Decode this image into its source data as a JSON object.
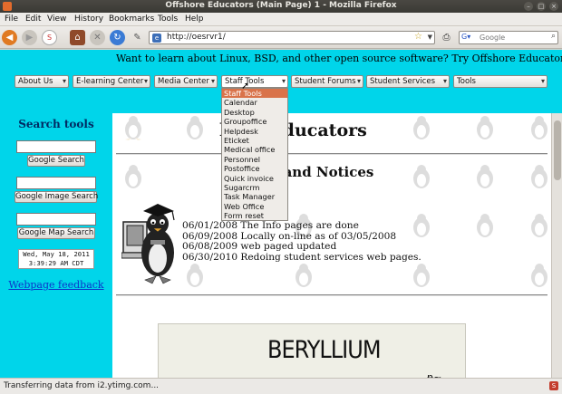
{
  "window": {
    "title": "Offshore Educators (Main Page) 1 - Mozilla Firefox"
  },
  "menubar": {
    "items": [
      "File",
      "Edit",
      "View",
      "History",
      "Bookmarks",
      "Tools",
      "Help"
    ]
  },
  "navbar": {
    "url": "http://oesrvr1/",
    "search_placeholder": "Google"
  },
  "page": {
    "marquee": "Want to learn about Linux, BSD, and other open source software? Try Offshore Educators where op",
    "selects": [
      {
        "label": "About Us"
      },
      {
        "label": "E-learning Center"
      },
      {
        "label": "Media Center"
      },
      {
        "label": "Staff Tools"
      },
      {
        "label": "Student Forums"
      },
      {
        "label": "Student Services"
      },
      {
        "label": "Tools"
      }
    ],
    "dropdown": {
      "options": [
        "Staff Tools",
        "Calendar",
        "Desktop",
        "Groupoffice",
        "Helpdesk",
        "Eticket",
        "Medical office",
        "Personnel",
        "Postoffice",
        "Quick invoice",
        "Sugarcrm",
        "Task Manager",
        "Web Office",
        "Form reset"
      ],
      "highlighted_index": 0
    },
    "sidebar": {
      "heading": "Search tools",
      "buttons": [
        "Google Search",
        "Google Image Search",
        "Google Map Search"
      ],
      "clock_line1": "Wed, May 18, 2011",
      "clock_line2": "3:39:29 AM CDT",
      "feedback_link": "Webpage feedback"
    },
    "main": {
      "title": "hore Educators",
      "news_heading": "ws and Notices",
      "news": [
        "06/01/2008 The Info pages are done",
        "06/09/2008 Locally on-line as of 03/05/2008",
        "06/08/2009 web paged updated",
        "06/30/2010 Redoing student services web pages."
      ],
      "banner_text": "BERYLLIUM"
    }
  },
  "status": {
    "text": "Transferring data from i2.ytimg.com..."
  },
  "colors": {
    "page_cyan": "#00d5ea",
    "link_blue": "#0c33c9",
    "menu_highlight": "#d9734a"
  }
}
